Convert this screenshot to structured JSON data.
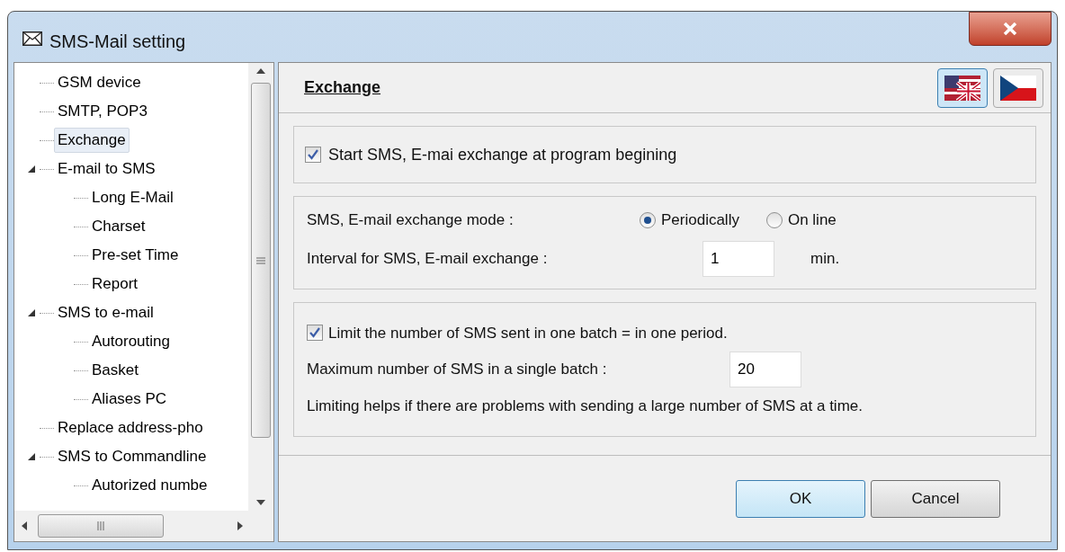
{
  "window": {
    "title": "SMS-Mail setting"
  },
  "tree": {
    "items": [
      {
        "label": "GSM device",
        "selected": false
      },
      {
        "label": "SMTP, POP3",
        "selected": false
      },
      {
        "label": "Exchange",
        "selected": true
      },
      {
        "label": "E-mail to SMS",
        "selected": false,
        "expanded": true,
        "children": [
          {
            "label": "Long E-Mail",
            "selected": false
          },
          {
            "label": "Charset",
            "selected": false
          },
          {
            "label": "Pre-set Time",
            "selected": false
          },
          {
            "label": "Report",
            "selected": false
          }
        ]
      },
      {
        "label": "SMS to e-mail",
        "selected": false,
        "expanded": true,
        "children": [
          {
            "label": "Autorouting",
            "selected": false
          },
          {
            "label": "Basket",
            "selected": false
          },
          {
            "label": "Aliases PC",
            "selected": false
          }
        ]
      },
      {
        "label": "Replace address-pho",
        "selected": false
      },
      {
        "label": "SMS to Commandline",
        "selected": false,
        "expanded": true,
        "children": [
          {
            "label": "Autorized numbe",
            "selected": false
          }
        ]
      }
    ]
  },
  "header": {
    "title": "Exchange",
    "languages": [
      {
        "kind": "english",
        "selected": true
      },
      {
        "kind": "czech",
        "selected": false
      }
    ]
  },
  "startup": {
    "label": "Start SMS, E-mai exchange at program begining",
    "checked": true
  },
  "mode": {
    "label": "SMS, E-mail exchange mode :",
    "options": [
      {
        "label": "Periodically",
        "selected": true
      },
      {
        "label": "On line",
        "selected": false
      }
    ]
  },
  "interval": {
    "label": "Interval for SMS, E-mail exchange :",
    "value": "1",
    "unit": "min."
  },
  "limit": {
    "label": "Limit the number of SMS sent in one batch = in one period.",
    "checked": true
  },
  "maximum": {
    "label": "Maximum number of SMS in a single batch :",
    "value": "20"
  },
  "note": "Limiting helps if there are problems with sending a large number of SMS at a time.",
  "buttons": [
    {
      "label": "OK",
      "focused": true
    },
    {
      "label": "Cancel",
      "focused": false
    }
  ]
}
